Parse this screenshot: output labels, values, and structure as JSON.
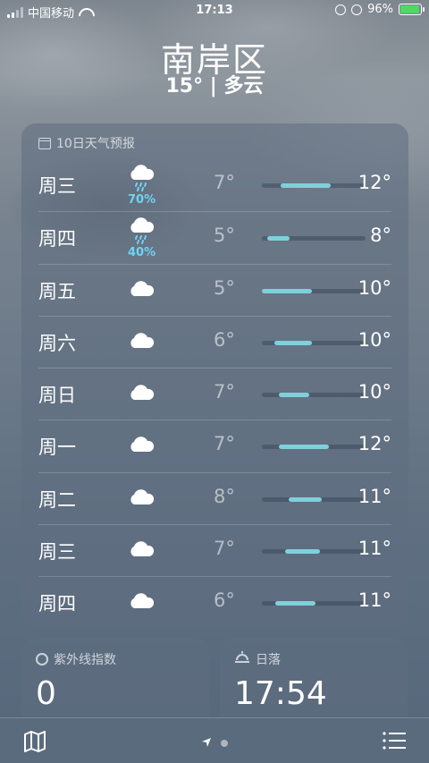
{
  "status_bar": {
    "carrier": "中国移动",
    "time": "17:13",
    "battery": "96%",
    "battery_level": 0.96
  },
  "header": {
    "city": "南岸区",
    "current": "15° | 多云"
  },
  "forecast": {
    "title": "10日天气预报",
    "title_icon": "calendar-icon",
    "days": [
      {
        "day": "周三",
        "icon": "cloud-rain-icon",
        "precip": "70%",
        "low": "7°",
        "high": "12°",
        "bar_start": 0.18,
        "bar_end": 0.66
      },
      {
        "day": "周四",
        "icon": "cloud-rain-icon",
        "precip": "40%",
        "low": "5°",
        "high": "8°",
        "bar_start": 0.05,
        "bar_end": 0.27
      },
      {
        "day": "周五",
        "icon": "cloud-icon",
        "precip": "",
        "low": "5°",
        "high": "10°",
        "bar_start": 0.0,
        "bar_end": 0.48
      },
      {
        "day": "周六",
        "icon": "cloud-icon",
        "precip": "",
        "low": "6°",
        "high": "10°",
        "bar_start": 0.12,
        "bar_end": 0.48
      },
      {
        "day": "周日",
        "icon": "cloud-icon",
        "precip": "",
        "low": "7°",
        "high": "10°",
        "bar_start": 0.16,
        "bar_end": 0.46
      },
      {
        "day": "周一",
        "icon": "cloud-icon",
        "precip": "",
        "low": "7°",
        "high": "12°",
        "bar_start": 0.16,
        "bar_end": 0.65
      },
      {
        "day": "周二",
        "icon": "cloud-icon",
        "precip": "",
        "low": "8°",
        "high": "11°",
        "bar_start": 0.26,
        "bar_end": 0.58
      },
      {
        "day": "周三",
        "icon": "cloud-icon",
        "precip": "",
        "low": "7°",
        "high": "11°",
        "bar_start": 0.22,
        "bar_end": 0.56
      },
      {
        "day": "周四",
        "icon": "cloud-icon",
        "precip": "",
        "low": "6°",
        "high": "11°",
        "bar_start": 0.13,
        "bar_end": 0.52
      }
    ]
  },
  "uv_card": {
    "label": "紫外线指数",
    "icon": "sun-icon",
    "value": "0"
  },
  "sunset_card": {
    "label": "日落",
    "icon": "sunset-icon",
    "value": "17:54"
  },
  "toolbar": {
    "map_icon": "map-icon",
    "location_icon": "location-arrow-icon",
    "list_icon": "list-icon"
  }
}
